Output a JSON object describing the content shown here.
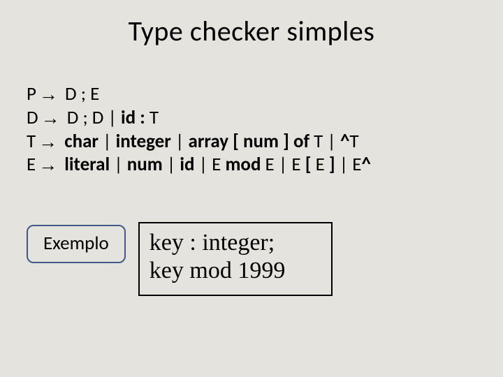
{
  "title": "Type checker simples",
  "grammar": {
    "line1": {
      "lhs": "P",
      "rhs": " D ; E"
    },
    "line2": {
      "lhs": "D",
      "rhs_plain": " D ; D | ",
      "rhs_bold": "id : ",
      "rhs_tail": "T"
    },
    "line3": {
      "lhs": "T",
      "rhs_bold": " char ",
      "pipe1": "| ",
      "b2": "integer ",
      "pipe2": "| ",
      "b3": "array [ num ] of ",
      "t1": "T ",
      "pipe3": "| ",
      "b4": "^",
      "t2": "T"
    },
    "line4": {
      "lhs": "E",
      "rhs_bold": " literal ",
      "pipe1": "| ",
      "b2": "num ",
      "pipe2": "| ",
      "b3": "id ",
      "pipe3": "| ",
      "t1": "E ",
      "b4": "mod ",
      "t2": "E ",
      "pipe4": "| ",
      "t3": "E ",
      "b5": "[ ",
      "t4": "E ",
      "b6": "] ",
      "pipe5": "| ",
      "t5": "E",
      "b7": "^"
    }
  },
  "example_label": "Exemplo",
  "example": {
    "line1": "key : integer;",
    "line2": "key mod 1999"
  },
  "arrow": "→"
}
